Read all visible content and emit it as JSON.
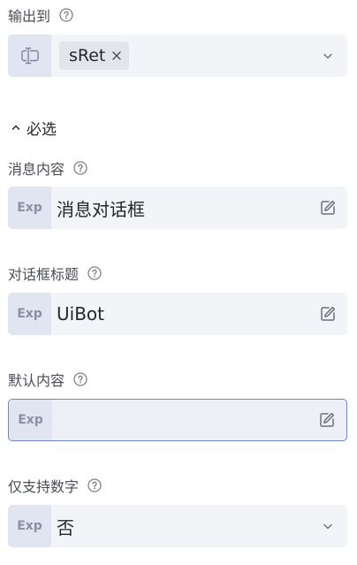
{
  "output": {
    "label": "输出到",
    "tag_value": "sRet",
    "icons": [
      "variable-icon",
      "close-icon",
      "chevron-down-icon",
      "help-icon"
    ]
  },
  "required_section": {
    "label": "必选",
    "expanded": true
  },
  "fields": {
    "message": {
      "label": "消息内容",
      "prefix": "Exp",
      "value": "消息对话框"
    },
    "title": {
      "label": "对话框标题",
      "prefix": "Exp",
      "value": "UiBot"
    },
    "default": {
      "label": "默认内容",
      "prefix": "Exp",
      "value": ""
    },
    "numbers_only": {
      "label": "仅支持数字",
      "prefix": "Exp",
      "value": "否"
    }
  },
  "colors": {
    "field_bg": "#f3f4f8",
    "prefix_bg": "#e1e4f1",
    "focus_border": "#6f86c4"
  }
}
